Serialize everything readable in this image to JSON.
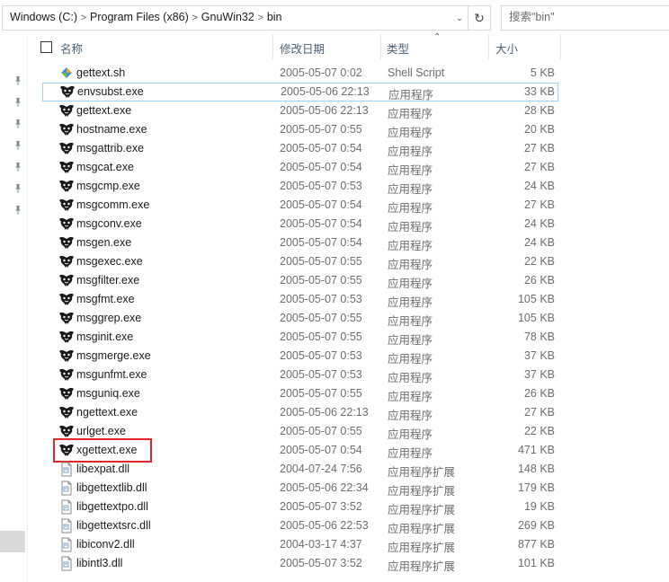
{
  "address": {
    "crumbs": [
      "Windows (C:)",
      "Program Files (x86)",
      "GnuWin32",
      "bin"
    ],
    "separator": ">",
    "dropdown_icon": "chevron-down-icon",
    "refresh_icon": "refresh-icon"
  },
  "search": {
    "placeholder": "搜索\"bin\""
  },
  "columns": {
    "name": "名称",
    "date": "修改日期",
    "type": "类型",
    "size": "大小"
  },
  "files": [
    {
      "name": "gettext.sh",
      "date": "2005-05-07 0:02",
      "type": "Shell Script",
      "size": "5 KB",
      "icon": "shell-script-icon"
    },
    {
      "name": "envsubst.exe",
      "date": "2005-05-06 22:13",
      "type": "应用程序",
      "size": "33 KB",
      "icon": "gnu-exe-icon"
    },
    {
      "name": "gettext.exe",
      "date": "2005-05-06 22:13",
      "type": "应用程序",
      "size": "28 KB",
      "icon": "gnu-exe-icon"
    },
    {
      "name": "hostname.exe",
      "date": "2005-05-07 0:55",
      "type": "应用程序",
      "size": "20 KB",
      "icon": "gnu-exe-icon"
    },
    {
      "name": "msgattrib.exe",
      "date": "2005-05-07 0:54",
      "type": "应用程序",
      "size": "27 KB",
      "icon": "gnu-exe-icon"
    },
    {
      "name": "msgcat.exe",
      "date": "2005-05-07 0:54",
      "type": "应用程序",
      "size": "27 KB",
      "icon": "gnu-exe-icon"
    },
    {
      "name": "msgcmp.exe",
      "date": "2005-05-07 0:53",
      "type": "应用程序",
      "size": "24 KB",
      "icon": "gnu-exe-icon"
    },
    {
      "name": "msgcomm.exe",
      "date": "2005-05-07 0:54",
      "type": "应用程序",
      "size": "27 KB",
      "icon": "gnu-exe-icon"
    },
    {
      "name": "msgconv.exe",
      "date": "2005-05-07 0:54",
      "type": "应用程序",
      "size": "24 KB",
      "icon": "gnu-exe-icon"
    },
    {
      "name": "msgen.exe",
      "date": "2005-05-07 0:54",
      "type": "应用程序",
      "size": "24 KB",
      "icon": "gnu-exe-icon"
    },
    {
      "name": "msgexec.exe",
      "date": "2005-05-07 0:55",
      "type": "应用程序",
      "size": "22 KB",
      "icon": "gnu-exe-icon"
    },
    {
      "name": "msgfilter.exe",
      "date": "2005-05-07 0:55",
      "type": "应用程序",
      "size": "26 KB",
      "icon": "gnu-exe-icon"
    },
    {
      "name": "msgfmt.exe",
      "date": "2005-05-07 0:53",
      "type": "应用程序",
      "size": "105 KB",
      "icon": "gnu-exe-icon"
    },
    {
      "name": "msggrep.exe",
      "date": "2005-05-07 0:55",
      "type": "应用程序",
      "size": "105 KB",
      "icon": "gnu-exe-icon"
    },
    {
      "name": "msginit.exe",
      "date": "2005-05-07 0:55",
      "type": "应用程序",
      "size": "78 KB",
      "icon": "gnu-exe-icon"
    },
    {
      "name": "msgmerge.exe",
      "date": "2005-05-07 0:53",
      "type": "应用程序",
      "size": "37 KB",
      "icon": "gnu-exe-icon"
    },
    {
      "name": "msgunfmt.exe",
      "date": "2005-05-07 0:53",
      "type": "应用程序",
      "size": "37 KB",
      "icon": "gnu-exe-icon"
    },
    {
      "name": "msguniq.exe",
      "date": "2005-05-07 0:55",
      "type": "应用程序",
      "size": "26 KB",
      "icon": "gnu-exe-icon"
    },
    {
      "name": "ngettext.exe",
      "date": "2005-05-06 22:13",
      "type": "应用程序",
      "size": "27 KB",
      "icon": "gnu-exe-icon"
    },
    {
      "name": "urlget.exe",
      "date": "2005-05-07 0:55",
      "type": "应用程序",
      "size": "22 KB",
      "icon": "gnu-exe-icon"
    },
    {
      "name": "xgettext.exe",
      "date": "2005-05-07 0:54",
      "type": "应用程序",
      "size": "471 KB",
      "icon": "gnu-exe-icon"
    },
    {
      "name": "libexpat.dll",
      "date": "2004-07-24 7:56",
      "type": "应用程序扩展",
      "size": "148 KB",
      "icon": "dll-file-icon"
    },
    {
      "name": "libgettextlib.dll",
      "date": "2005-05-06 22:34",
      "type": "应用程序扩展",
      "size": "179 KB",
      "icon": "dll-file-icon"
    },
    {
      "name": "libgettextpo.dll",
      "date": "2005-05-07 3:52",
      "type": "应用程序扩展",
      "size": "19 KB",
      "icon": "dll-file-icon"
    },
    {
      "name": "libgettextsrc.dll",
      "date": "2005-05-06 22:53",
      "type": "应用程序扩展",
      "size": "269 KB",
      "icon": "dll-file-icon"
    },
    {
      "name": "libiconv2.dll",
      "date": "2004-03-17 4:37",
      "type": "应用程序扩展",
      "size": "877 KB",
      "icon": "dll-file-icon"
    },
    {
      "name": "libintl3.dll",
      "date": "2005-05-07 3:52",
      "type": "应用程序扩展",
      "size": "101 KB",
      "icon": "dll-file-icon"
    }
  ],
  "focused_row": 1,
  "highlighted_row": 20,
  "colors": {
    "header_text": "#4c607a",
    "focus_border": "#99d1ff",
    "highlight_box": "#e0252b",
    "meta_text": "#6d6d6d"
  }
}
